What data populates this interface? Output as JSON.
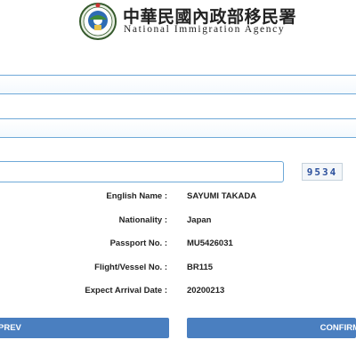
{
  "header": {
    "title_zh": "中華民國內政部移民署",
    "title_en": "National Immigration Agency",
    "logo_icon": "national-immigration-agency-emblem"
  },
  "captcha": {
    "code": "9534"
  },
  "details": [
    {
      "label": "English Name :",
      "value": "SAYUMI TAKADA"
    },
    {
      "label": "Nationality :",
      "value": "Japan"
    },
    {
      "label": "Passport No. :",
      "value": "MU5426031"
    },
    {
      "label": "Flight/Vessel No. :",
      "value": "BR115"
    },
    {
      "label": "Expect Arrival Date :",
      "value": "20200213"
    }
  ],
  "buttons": {
    "prev_label": "PREV",
    "confirm_label": "CONFIRM"
  },
  "colors": {
    "input_border": "#6fa9d8",
    "button_bg": "#4a7fc0",
    "captcha_text": "#2a4f9c"
  }
}
